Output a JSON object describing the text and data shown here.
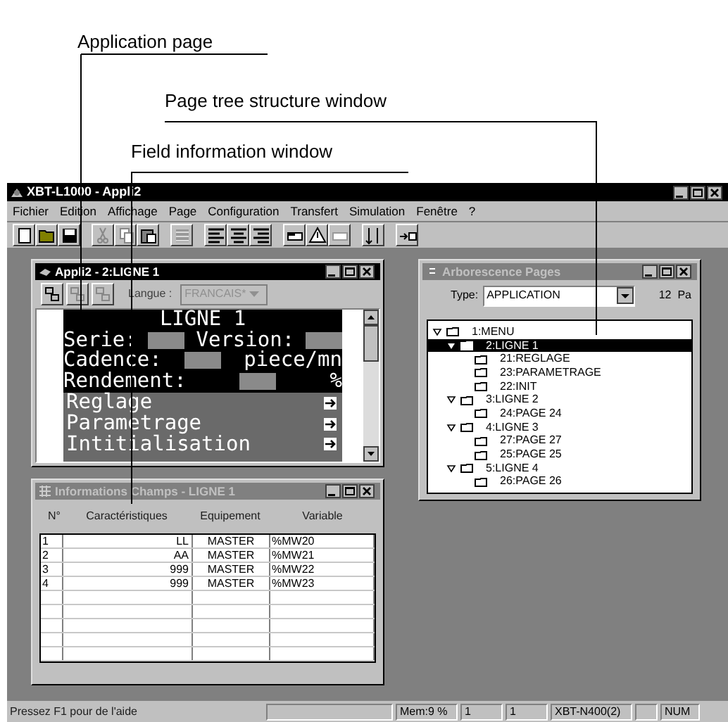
{
  "callouts": [
    {
      "text": "Application page"
    },
    {
      "text": "Page tree structure window"
    },
    {
      "text": "Field information window"
    }
  ],
  "window": {
    "title": "XBT-L1000 - Appli2"
  },
  "menu": [
    "Fichier",
    "Edition",
    "Affichage",
    "Page",
    "Configuration",
    "Transfert",
    "Simulation",
    "Fenêtre",
    "?"
  ],
  "page_window": {
    "title": "Appli2 - 2:LIGNE 1",
    "active": true,
    "language_label": "Langue :",
    "language": "FRANCAIS*",
    "lcd_lines": [
      {
        "kind": "title",
        "parts": [
          {
            "kind": "text",
            "text": "LIGNE 1"
          }
        ]
      },
      {
        "kind": "fields",
        "parts": [
          {
            "kind": "text",
            "text": "Serie:"
          },
          {
            "kind": "field"
          },
          {
            "kind": "text",
            "text": "Version:"
          },
          {
            "kind": "field"
          }
        ]
      },
      {
        "kind": "fields",
        "parts": [
          {
            "kind": "text",
            "text": "Cadence:"
          },
          {
            "kind": "field"
          },
          {
            "kind": "text",
            "text": "piece/mn"
          }
        ]
      },
      {
        "kind": "fields",
        "parts": [
          {
            "kind": "text",
            "text": "Rendement:"
          },
          {
            "kind": "field"
          },
          {
            "kind": "text",
            "text": "%"
          }
        ]
      },
      {
        "kind": "link",
        "parts": [
          {
            "kind": "text",
            "text": "Reglage"
          }
        ]
      },
      {
        "kind": "link",
        "parts": [
          {
            "kind": "text",
            "text": "Parametrage"
          }
        ]
      },
      {
        "kind": "link",
        "parts": [
          {
            "kind": "text",
            "text": "Intitialisation"
          }
        ]
      }
    ]
  },
  "field_window": {
    "title": "Informations Champs - LIGNE 1",
    "active": false,
    "columns": [
      "N°",
      "Caractéristiques",
      "Equipement",
      "Variable"
    ],
    "rows": [
      [
        "1",
        "LL",
        "MASTER",
        "%MW20"
      ],
      [
        "2",
        "AA",
        "MASTER",
        "%MW21"
      ],
      [
        "3",
        "999",
        "MASTER",
        "%MW22"
      ],
      [
        "4",
        "999",
        "MASTER",
        "%MW23"
      ]
    ]
  },
  "tree_window": {
    "title": "Arborescence Pages",
    "active": false,
    "type_label": "Type:",
    "type": "APPLICATION",
    "count": "12  Pa",
    "tree": [
      {
        "label": "1:MENU",
        "expanded": true,
        "selected": false,
        "children": [
          {
            "label": "2:LIGNE 1",
            "expanded": true,
            "selected": true,
            "children": [
              {
                "label": "21:REGLAGE",
                "selected": false
              },
              {
                "label": "23:PARAMETRAGE",
                "selected": false
              },
              {
                "label": "22:INIT",
                "selected": false
              }
            ]
          },
          {
            "label": "3:LIGNE 2",
            "expanded": true,
            "selected": false,
            "children": [
              {
                "label": "24:PAGE 24",
                "selected": false
              }
            ]
          },
          {
            "label": "4:LIGNE 3",
            "expanded": true,
            "selected": false,
            "children": [
              {
                "label": "27:PAGE 27",
                "selected": false
              },
              {
                "label": "25:PAGE 25",
                "selected": false
              }
            ]
          },
          {
            "label": "5:LIGNE 4",
            "expanded": true,
            "selected": false,
            "children": [
              {
                "label": "26:PAGE 26",
                "selected": false
              }
            ]
          }
        ]
      }
    ]
  },
  "status_bar": {
    "message": "Pressez F1 pour de l'aide",
    "panels": [
      "Mem:9 %",
      "1",
      "1",
      "XBT-N400(2)",
      "NUM"
    ]
  }
}
